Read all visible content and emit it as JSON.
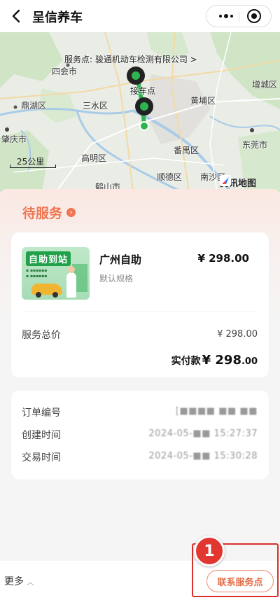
{
  "header": {
    "title": "呈信养车"
  },
  "map": {
    "store_label": "服务点: 骏通机动车检测有限公司 >",
    "pickup_label": "接车点",
    "scale": "25公里",
    "provider": "腾讯地图",
    "places": {
      "sihui": "四会市",
      "dinghu": "鼎湖区",
      "sanshui": "三水区",
      "zhaoqing": "肇庆市",
      "gaoming": "高明区",
      "heshan": "鹤山市",
      "huangpu": "黄埔区",
      "zengcheng": "增城区",
      "dongguan": "东莞市",
      "panyu": "番禺区",
      "shunde": "顺德区",
      "nansha": "南沙区"
    }
  },
  "order": {
    "status": "待服务",
    "item": {
      "image_title": "自助到站",
      "name": "广州自助",
      "price": "¥ 298.00",
      "spec": "默认规格"
    },
    "total_label": "服务总价",
    "total_value": "¥ 298.00",
    "paid_label": "实付款",
    "paid_symbol": "¥",
    "paid_int": "298",
    "paid_dec": ".00"
  },
  "info": {
    "order_no_label": "订单编号",
    "order_no_value": "[■■■■ ■■ ■■",
    "created_label": "创建时间",
    "created_value": "2024-05-■■ 15:27:37",
    "paid_time_label": "交易时间",
    "paid_time_value": "2024-05-■■ 15:30:28"
  },
  "bottom": {
    "more_label": "更多",
    "contact_label": "联系服务点"
  },
  "annotation": {
    "step": "1"
  },
  "colors": {
    "accent": "#ee7652",
    "highlight": "#d9302a",
    "route": "#2fb34f"
  }
}
